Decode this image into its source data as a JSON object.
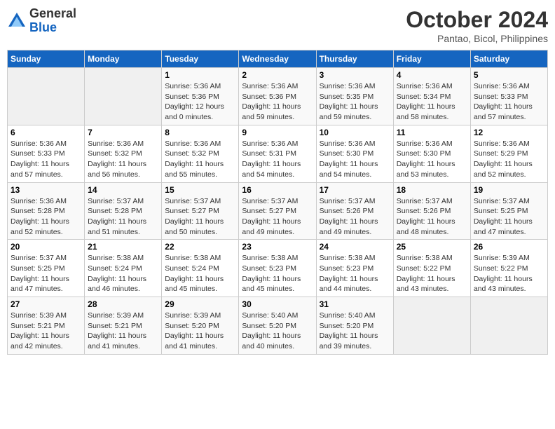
{
  "header": {
    "logo_general": "General",
    "logo_blue": "Blue",
    "month_title": "October 2024",
    "location": "Pantao, Bicol, Philippines"
  },
  "weekdays": [
    "Sunday",
    "Monday",
    "Tuesday",
    "Wednesday",
    "Thursday",
    "Friday",
    "Saturday"
  ],
  "rows": [
    [
      {
        "day": "",
        "sunrise": "",
        "sunset": "",
        "daylight": ""
      },
      {
        "day": "",
        "sunrise": "",
        "sunset": "",
        "daylight": ""
      },
      {
        "day": "1",
        "sunrise": "Sunrise: 5:36 AM",
        "sunset": "Sunset: 5:36 PM",
        "daylight": "Daylight: 12 hours and 0 minutes."
      },
      {
        "day": "2",
        "sunrise": "Sunrise: 5:36 AM",
        "sunset": "Sunset: 5:36 PM",
        "daylight": "Daylight: 11 hours and 59 minutes."
      },
      {
        "day": "3",
        "sunrise": "Sunrise: 5:36 AM",
        "sunset": "Sunset: 5:35 PM",
        "daylight": "Daylight: 11 hours and 59 minutes."
      },
      {
        "day": "4",
        "sunrise": "Sunrise: 5:36 AM",
        "sunset": "Sunset: 5:34 PM",
        "daylight": "Daylight: 11 hours and 58 minutes."
      },
      {
        "day": "5",
        "sunrise": "Sunrise: 5:36 AM",
        "sunset": "Sunset: 5:33 PM",
        "daylight": "Daylight: 11 hours and 57 minutes."
      }
    ],
    [
      {
        "day": "6",
        "sunrise": "Sunrise: 5:36 AM",
        "sunset": "Sunset: 5:33 PM",
        "daylight": "Daylight: 11 hours and 57 minutes."
      },
      {
        "day": "7",
        "sunrise": "Sunrise: 5:36 AM",
        "sunset": "Sunset: 5:32 PM",
        "daylight": "Daylight: 11 hours and 56 minutes."
      },
      {
        "day": "8",
        "sunrise": "Sunrise: 5:36 AM",
        "sunset": "Sunset: 5:32 PM",
        "daylight": "Daylight: 11 hours and 55 minutes."
      },
      {
        "day": "9",
        "sunrise": "Sunrise: 5:36 AM",
        "sunset": "Sunset: 5:31 PM",
        "daylight": "Daylight: 11 hours and 54 minutes."
      },
      {
        "day": "10",
        "sunrise": "Sunrise: 5:36 AM",
        "sunset": "Sunset: 5:30 PM",
        "daylight": "Daylight: 11 hours and 54 minutes."
      },
      {
        "day": "11",
        "sunrise": "Sunrise: 5:36 AM",
        "sunset": "Sunset: 5:30 PM",
        "daylight": "Daylight: 11 hours and 53 minutes."
      },
      {
        "day": "12",
        "sunrise": "Sunrise: 5:36 AM",
        "sunset": "Sunset: 5:29 PM",
        "daylight": "Daylight: 11 hours and 52 minutes."
      }
    ],
    [
      {
        "day": "13",
        "sunrise": "Sunrise: 5:36 AM",
        "sunset": "Sunset: 5:28 PM",
        "daylight": "Daylight: 11 hours and 52 minutes."
      },
      {
        "day": "14",
        "sunrise": "Sunrise: 5:37 AM",
        "sunset": "Sunset: 5:28 PM",
        "daylight": "Daylight: 11 hours and 51 minutes."
      },
      {
        "day": "15",
        "sunrise": "Sunrise: 5:37 AM",
        "sunset": "Sunset: 5:27 PM",
        "daylight": "Daylight: 11 hours and 50 minutes."
      },
      {
        "day": "16",
        "sunrise": "Sunrise: 5:37 AM",
        "sunset": "Sunset: 5:27 PM",
        "daylight": "Daylight: 11 hours and 49 minutes."
      },
      {
        "day": "17",
        "sunrise": "Sunrise: 5:37 AM",
        "sunset": "Sunset: 5:26 PM",
        "daylight": "Daylight: 11 hours and 49 minutes."
      },
      {
        "day": "18",
        "sunrise": "Sunrise: 5:37 AM",
        "sunset": "Sunset: 5:26 PM",
        "daylight": "Daylight: 11 hours and 48 minutes."
      },
      {
        "day": "19",
        "sunrise": "Sunrise: 5:37 AM",
        "sunset": "Sunset: 5:25 PM",
        "daylight": "Daylight: 11 hours and 47 minutes."
      }
    ],
    [
      {
        "day": "20",
        "sunrise": "Sunrise: 5:37 AM",
        "sunset": "Sunset: 5:25 PM",
        "daylight": "Daylight: 11 hours and 47 minutes."
      },
      {
        "day": "21",
        "sunrise": "Sunrise: 5:38 AM",
        "sunset": "Sunset: 5:24 PM",
        "daylight": "Daylight: 11 hours and 46 minutes."
      },
      {
        "day": "22",
        "sunrise": "Sunrise: 5:38 AM",
        "sunset": "Sunset: 5:24 PM",
        "daylight": "Daylight: 11 hours and 45 minutes."
      },
      {
        "day": "23",
        "sunrise": "Sunrise: 5:38 AM",
        "sunset": "Sunset: 5:23 PM",
        "daylight": "Daylight: 11 hours and 45 minutes."
      },
      {
        "day": "24",
        "sunrise": "Sunrise: 5:38 AM",
        "sunset": "Sunset: 5:23 PM",
        "daylight": "Daylight: 11 hours and 44 minutes."
      },
      {
        "day": "25",
        "sunrise": "Sunrise: 5:38 AM",
        "sunset": "Sunset: 5:22 PM",
        "daylight": "Daylight: 11 hours and 43 minutes."
      },
      {
        "day": "26",
        "sunrise": "Sunrise: 5:39 AM",
        "sunset": "Sunset: 5:22 PM",
        "daylight": "Daylight: 11 hours and 43 minutes."
      }
    ],
    [
      {
        "day": "27",
        "sunrise": "Sunrise: 5:39 AM",
        "sunset": "Sunset: 5:21 PM",
        "daylight": "Daylight: 11 hours and 42 minutes."
      },
      {
        "day": "28",
        "sunrise": "Sunrise: 5:39 AM",
        "sunset": "Sunset: 5:21 PM",
        "daylight": "Daylight: 11 hours and 41 minutes."
      },
      {
        "day": "29",
        "sunrise": "Sunrise: 5:39 AM",
        "sunset": "Sunset: 5:20 PM",
        "daylight": "Daylight: 11 hours and 41 minutes."
      },
      {
        "day": "30",
        "sunrise": "Sunrise: 5:40 AM",
        "sunset": "Sunset: 5:20 PM",
        "daylight": "Daylight: 11 hours and 40 minutes."
      },
      {
        "day": "31",
        "sunrise": "Sunrise: 5:40 AM",
        "sunset": "Sunset: 5:20 PM",
        "daylight": "Daylight: 11 hours and 39 minutes."
      },
      {
        "day": "",
        "sunrise": "",
        "sunset": "",
        "daylight": ""
      },
      {
        "day": "",
        "sunrise": "",
        "sunset": "",
        "daylight": ""
      }
    ]
  ]
}
